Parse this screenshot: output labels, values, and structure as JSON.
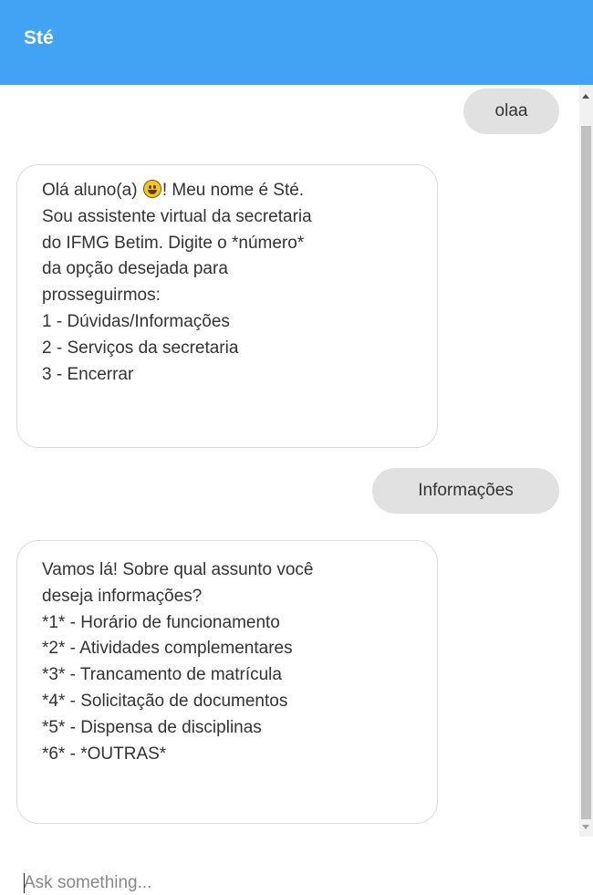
{
  "header": {
    "title": "Sté"
  },
  "messages": [
    {
      "role": "user",
      "text": "olaa"
    },
    {
      "role": "bot",
      "lines": [
        "Olá aluno(a)",
        "! Meu nome é Sté.",
        "Sou assistente virtual da secretaria",
        "do IFMG Betim. Digite o *número*",
        "da opção desejada para",
        "prosseguirmos:",
        "1 - Dúvidas/Informações",
        "2 - Serviços da secretaria",
        "3 - Encerrar"
      ],
      "emoji": "smiley-emoji"
    },
    {
      "role": "user",
      "text": "Informações"
    },
    {
      "role": "bot",
      "lines": [
        "Vamos lá! Sobre qual assunto você",
        "deseja informações?",
        "*1* - Horário de funcionamento",
        "*2* - Atividades complementares",
        "*3* - Trancamento de matrícula",
        "*4* - Solicitação de documentos",
        "*5* - Dispensa de disciplinas",
        "*6* - *OUTRAS*"
      ]
    }
  ],
  "composer": {
    "placeholder": "Ask something..."
  },
  "colors": {
    "header_bg": "#42a2f4",
    "user_bubble": "#e1e1e1",
    "bot_border": "#dcdcdc"
  }
}
